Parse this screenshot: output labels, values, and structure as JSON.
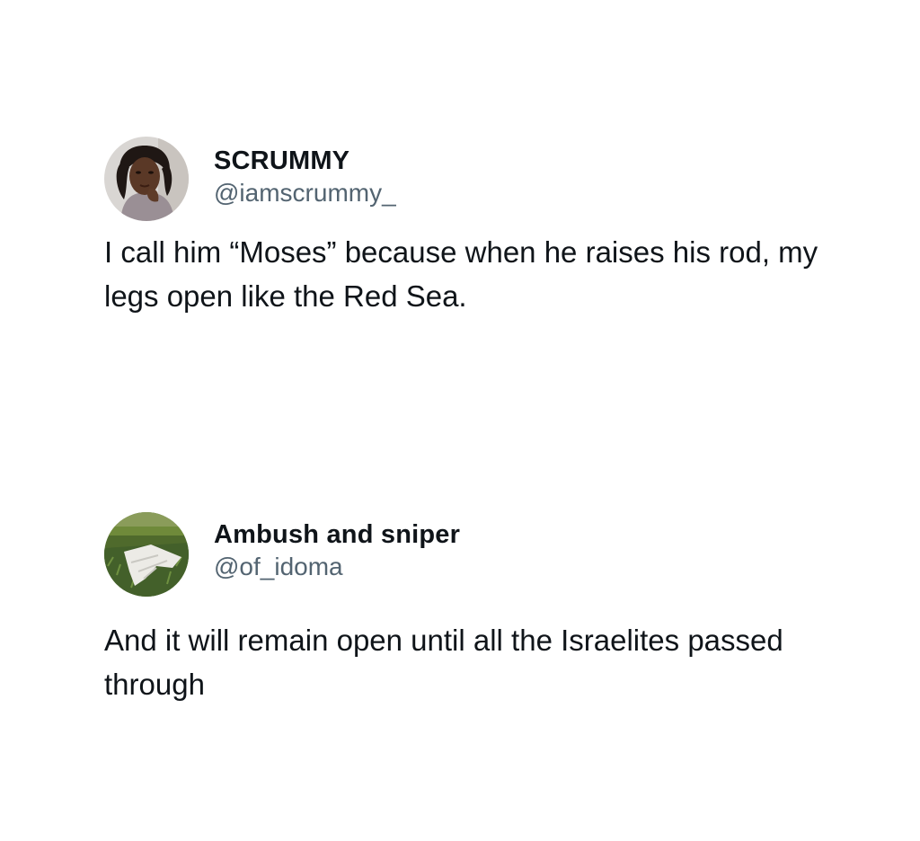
{
  "tweets": [
    {
      "display_name": "SCRUMMY",
      "handle": "@iamscrummy_",
      "text": "I call him “Moses” because when he raises his rod, my legs open like the Red Sea.",
      "avatar_icon": "profile-photo-woman"
    },
    {
      "display_name": "Ambush and sniper",
      "handle": "@of_idoma",
      "text": "And it will remain open until  all the Israelites passed through",
      "avatar_icon": "profile-photo-cloth-on-grass"
    }
  ],
  "colors": {
    "background": "#ffffff",
    "primary_text": "#0f1419",
    "secondary_text": "#536471"
  }
}
